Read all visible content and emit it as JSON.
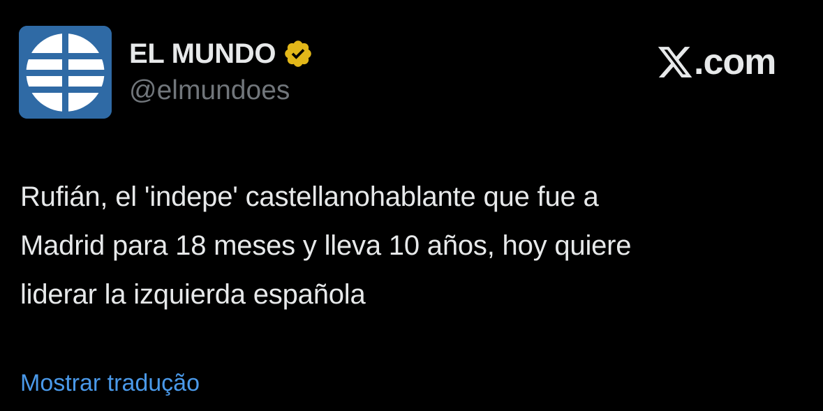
{
  "author": {
    "display_name": "EL MUNDO",
    "handle": "@elmundoes",
    "verified_badge_icon": "verified-gold-badge-icon",
    "verified_badge_color": "#e2b719",
    "avatar_icon": "el-mundo-globe-logo",
    "avatar_color": "#2f6aa5"
  },
  "brand": {
    "icon": "x-logo-icon",
    "text": ".com"
  },
  "tweet": {
    "text": "Rufián, el 'indepe' castellanohablante que fue a\nMadrid para 18 meses y lleva 10 años, hoy quiere\nliderar la izquierda española"
  },
  "translate": {
    "label": "Mostrar tradução",
    "color": "#4a99e9"
  }
}
